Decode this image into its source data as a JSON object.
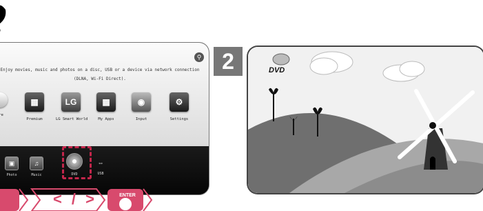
{
  "home": {
    "message": "Enjoy movies, music and photos on a disc, USB or a device via network connection (DLNA, Wi-Fi Direct).",
    "apps": [
      {
        "label": "Premium",
        "icon": "premium-icon"
      },
      {
        "label": "LG Smart World",
        "icon": "lg-logo-icon",
        "glyph": "LG"
      },
      {
        "label": "My Apps",
        "icon": "apps-grid-icon"
      },
      {
        "label": "Input",
        "icon": "input-icon"
      },
      {
        "label": "Settings",
        "icon": "gear-icon",
        "glyph": "⚙"
      }
    ],
    "partial_app_label": "are",
    "sources": [
      {
        "label": "Photo",
        "icon": "photo-icon",
        "glyph": "▣"
      },
      {
        "label": "Music",
        "icon": "music-icon",
        "glyph": "♫"
      },
      {
        "label": "DVD",
        "icon": "dvd-disc-icon",
        "glyph": "●"
      },
      {
        "label": "USB",
        "icon": "usb-icon",
        "glyph": "⇔"
      }
    ]
  },
  "buttons": {
    "arrows": "< / >",
    "enter": "ENTER"
  },
  "step": {
    "number": "2"
  },
  "player": {
    "dvd_label": "DVD"
  },
  "colors": {
    "highlight": "#c4264b",
    "step_badge": "#777777",
    "sky": "#f1f1f1",
    "hill_dark": "#6f6f6f",
    "hill_light": "#a8a8a8"
  }
}
